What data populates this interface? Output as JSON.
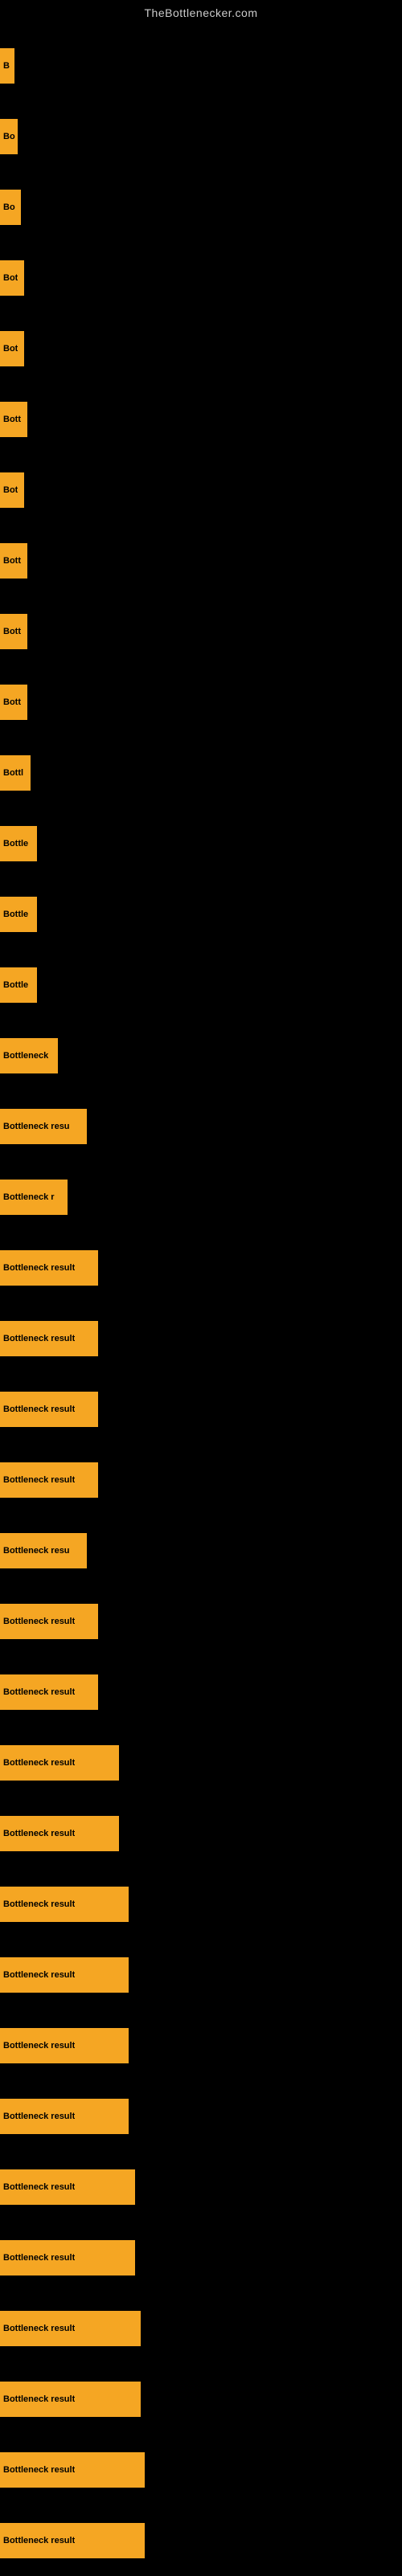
{
  "site_title": "TheBottlenecker.com",
  "bars": [
    {
      "label": "B",
      "width": 18
    },
    {
      "label": "Bo",
      "width": 22
    },
    {
      "label": "Bo",
      "width": 26
    },
    {
      "label": "Bot",
      "width": 30
    },
    {
      "label": "Bot",
      "width": 30
    },
    {
      "label": "Bott",
      "width": 34
    },
    {
      "label": "Bot",
      "width": 30
    },
    {
      "label": "Bott",
      "width": 34
    },
    {
      "label": "Bott",
      "width": 34
    },
    {
      "label": "Bott",
      "width": 34
    },
    {
      "label": "Bottl",
      "width": 38
    },
    {
      "label": "Bottle",
      "width": 46
    },
    {
      "label": "Bottle",
      "width": 46
    },
    {
      "label": "Bottle",
      "width": 46
    },
    {
      "label": "Bottleneck",
      "width": 72
    },
    {
      "label": "Bottleneck resu",
      "width": 108
    },
    {
      "label": "Bottleneck r",
      "width": 84
    },
    {
      "label": "Bottleneck result",
      "width": 122
    },
    {
      "label": "Bottleneck result",
      "width": 122
    },
    {
      "label": "Bottleneck result",
      "width": 122
    },
    {
      "label": "Bottleneck result",
      "width": 122
    },
    {
      "label": "Bottleneck resu",
      "width": 108
    },
    {
      "label": "Bottleneck result",
      "width": 122
    },
    {
      "label": "Bottleneck result",
      "width": 122
    },
    {
      "label": "Bottleneck result",
      "width": 148
    },
    {
      "label": "Bottleneck result",
      "width": 148
    },
    {
      "label": "Bottleneck result",
      "width": 160
    },
    {
      "label": "Bottleneck result",
      "width": 160
    },
    {
      "label": "Bottleneck result",
      "width": 160
    },
    {
      "label": "Bottleneck result",
      "width": 160
    },
    {
      "label": "Bottleneck result",
      "width": 168
    },
    {
      "label": "Bottleneck result",
      "width": 168
    },
    {
      "label": "Bottleneck result",
      "width": 175
    },
    {
      "label": "Bottleneck result",
      "width": 175
    },
    {
      "label": "Bottleneck result",
      "width": 180
    },
    {
      "label": "Bottleneck result",
      "width": 180
    }
  ]
}
